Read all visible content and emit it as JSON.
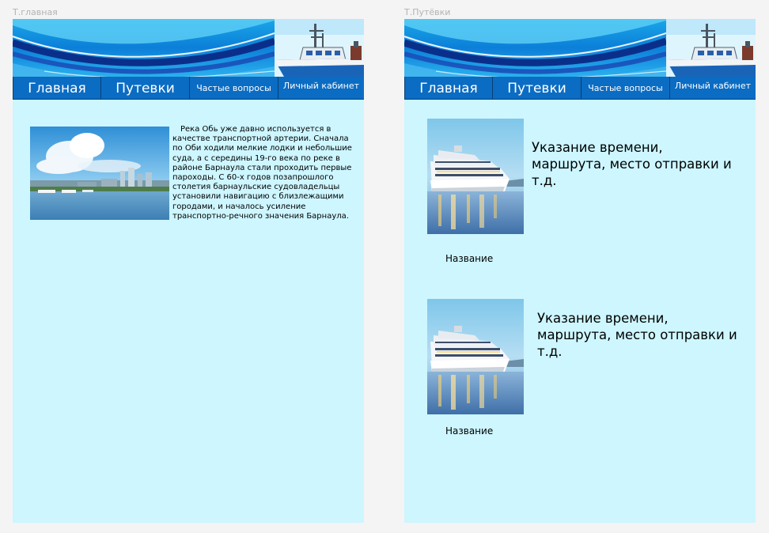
{
  "frames": {
    "home": {
      "label": "Т.главная"
    },
    "tours": {
      "label": "Т.Путёвки"
    }
  },
  "nav": {
    "home": "Главная",
    "tours": "Путевки",
    "faq": "Частые вопросы",
    "account": "Личный кабинет"
  },
  "home": {
    "article": "Река Обь уже давно используется в качестве транспортной артерии. Сначала по Оби ходили мелкие лодки и небольшие суда, а с середины 19-го века по реке в районе Барнаула стали проходить первые пароходы. С 60-х годов позапрошлого столетия барнаульские судовладельцы установили навигацию с близлежащими городами, и началось усиление транспортно-речного значения Барнаула."
  },
  "tours": [
    {
      "description": "Указание времени, маршрута, место отправки и т.д.",
      "name": "Название"
    },
    {
      "description": "Указание времени, маршрута, место отправки и т.д.",
      "name": "Название"
    }
  ],
  "colors": {
    "page_bg": "#cdf6ff",
    "nav_bg": "#0b6cc3",
    "canvas_bg": "#f4f4f4"
  },
  "icons": {
    "banner_ship": "ship-icon"
  }
}
